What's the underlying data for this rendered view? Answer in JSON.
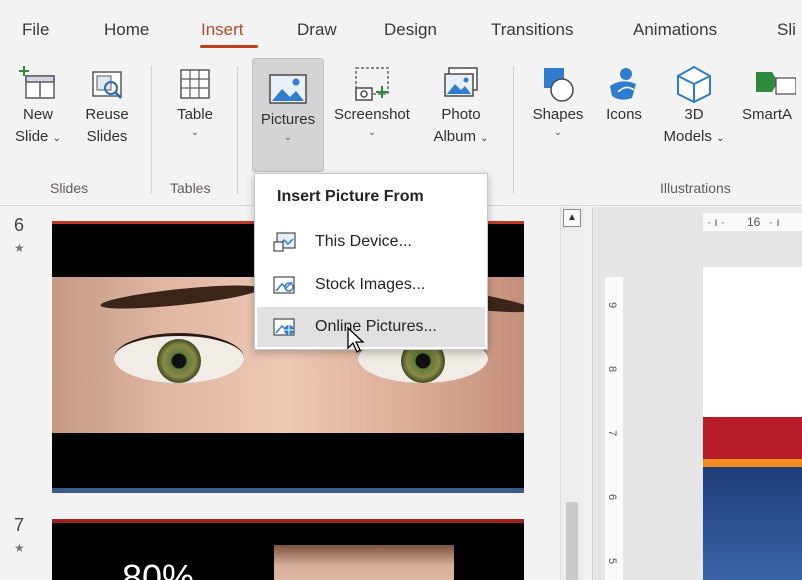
{
  "menu": {
    "tabs": [
      {
        "label": "File"
      },
      {
        "label": "Home"
      },
      {
        "label": "Insert"
      },
      {
        "label": "Draw"
      },
      {
        "label": "Design"
      },
      {
        "label": "Transitions"
      },
      {
        "label": "Animations"
      },
      {
        "label": "Sli"
      }
    ],
    "active_tab": "Insert"
  },
  "ribbon": {
    "groups": [
      {
        "label": "Slides"
      },
      {
        "label": "Tables"
      },
      {
        "label": "Illustrations"
      }
    ],
    "buttons": {
      "new_slide": {
        "line1": "New",
        "line2": "Slide"
      },
      "reuse_slides": {
        "line1": "Reuse",
        "line2": "Slides"
      },
      "table": {
        "line1": "Table"
      },
      "pictures": {
        "line1": "Pictures"
      },
      "screenshot": {
        "line1": "Screenshot"
      },
      "photo_album": {
        "line1": "Photo",
        "line2": "Album"
      },
      "shapes": {
        "line1": "Shapes"
      },
      "icons": {
        "line1": "Icons"
      },
      "models_3d": {
        "line1": "3D",
        "line2": "Models"
      },
      "smartart": {
        "line1": "SmartA"
      }
    },
    "caret": "⌄"
  },
  "pictures_menu": {
    "title": "Insert Picture From",
    "items": [
      {
        "label": "This Device..."
      },
      {
        "label": "Stock Images..."
      },
      {
        "label": "Online Pictures..."
      }
    ]
  },
  "thumbnails": {
    "slides": [
      {
        "number": "6",
        "marker": "★"
      },
      {
        "number": "7",
        "marker": "★"
      }
    ],
    "slide7_text": "80%"
  },
  "rulers": {
    "horizontal": "16",
    "vertical": [
      "9",
      "8",
      "7",
      "6",
      "5"
    ]
  },
  "colors": {
    "accent": "#c43e1c",
    "ribbon_bg": "#f3f3f3"
  }
}
